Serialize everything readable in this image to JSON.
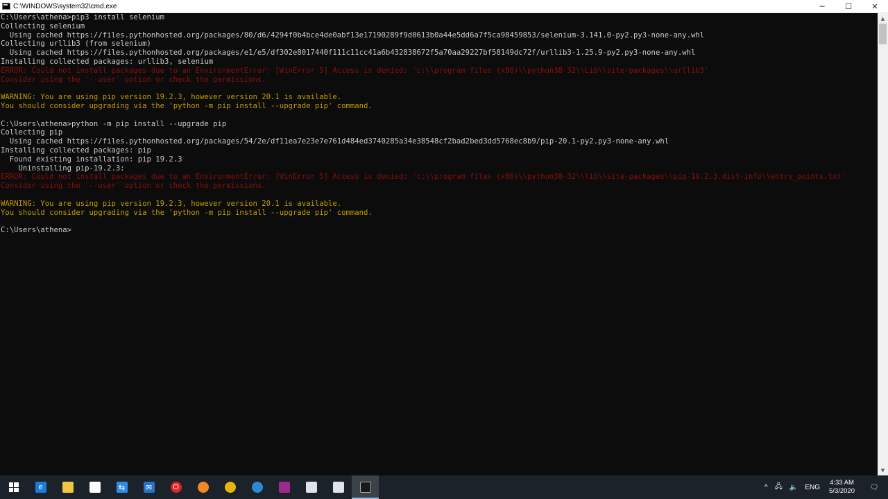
{
  "window": {
    "title": "C:\\WINDOWS\\system32\\cmd.exe",
    "controls": {
      "minimize": "─",
      "maximize": "☐",
      "close": "✕"
    }
  },
  "console": {
    "lines": [
      {
        "text": "C:\\Users\\athena>pip3 install selenium",
        "type": "normal"
      },
      {
        "text": "Collecting selenium",
        "type": "normal"
      },
      {
        "text": "  Using cached https://files.pythonhosted.org/packages/80/d6/4294f0b4bce4de0abf13e17190289f9d0613b0a44e5dd6a7f5ca98459853/selenium-3.141.0-py2.py3-none-any.whl",
        "type": "normal"
      },
      {
        "text": "Collecting urllib3 (from selenium)",
        "type": "normal"
      },
      {
        "text": "  Using cached https://files.pythonhosted.org/packages/e1/e5/df302e8017440f111c11cc41a6b432838672f5a70aa29227bf58149dc72f/urllib3-1.25.9-py2.py3-none-any.whl",
        "type": "normal"
      },
      {
        "text": "Installing collected packages: urllib3, selenium",
        "type": "normal"
      },
      {
        "text": "ERROR: Could not install packages due to an EnvironmentError: [WinError 5] Access is denied: 'c:\\\\program files (x86)\\\\python38-32\\\\Lib\\\\site-packages\\\\urllib3'",
        "type": "error"
      },
      {
        "text": "Consider using the `--user` option or check the permissions.",
        "type": "error"
      },
      {
        "text": "",
        "type": "normal"
      },
      {
        "text": "WARNING: You are using pip version 19.2.3, however version 20.1 is available.",
        "type": "warning"
      },
      {
        "text": "You should consider upgrading via the 'python -m pip install --upgrade pip' command.",
        "type": "warning"
      },
      {
        "text": "",
        "type": "normal"
      },
      {
        "text": "C:\\Users\\athena>python -m pip install --upgrade pip",
        "type": "normal"
      },
      {
        "text": "Collecting pip",
        "type": "normal"
      },
      {
        "text": "  Using cached https://files.pythonhosted.org/packages/54/2e/df11ea7e23e7e761d484ed3740285a34e38548cf2bad2bed3dd5768ec8b9/pip-20.1-py2.py3-none-any.whl",
        "type": "normal"
      },
      {
        "text": "Installing collected packages: pip",
        "type": "normal"
      },
      {
        "text": "  Found existing installation: pip 19.2.3",
        "type": "normal"
      },
      {
        "text": "    Uninstalling pip-19.2.3:",
        "type": "normal"
      },
      {
        "text": "ERROR: Could not install packages due to an EnvironmentError: [WinError 5] Access is denied: 'c:\\\\program files (x86)\\\\python38-32\\\\lib\\\\site-packages\\\\pip-19.2.3.dist-info\\\\entry_points.txt'",
        "type": "error"
      },
      {
        "text": "Consider using the `--user` option or check the permissions.",
        "type": "error"
      },
      {
        "text": "",
        "type": "normal"
      },
      {
        "text": "WARNING: You are using pip version 19.2.3, however version 20.1 is available.",
        "type": "warning"
      },
      {
        "text": "You should consider upgrading via the 'python -m pip install --upgrade pip' command.",
        "type": "warning"
      },
      {
        "text": "",
        "type": "normal"
      },
      {
        "text": "C:\\Users\\athena>",
        "type": "normal"
      }
    ],
    "colors": {
      "background": "#0c0c0c",
      "normal": "#cccccc",
      "error": "#8b0d0d",
      "warning": "#c19c00"
    }
  },
  "taskbar": {
    "apps": [
      {
        "name": "edge-icon",
        "color": "#1e7ad8",
        "glyph": "e"
      },
      {
        "name": "file-explorer-icon",
        "color": "#f0c541",
        "glyph": ""
      },
      {
        "name": "store-icon",
        "color": "#ffffff",
        "glyph": ""
      },
      {
        "name": "teamviewer-icon",
        "color": "#2d8cea",
        "glyph": "⇆"
      },
      {
        "name": "mail-icon",
        "color": "#2672c9",
        "glyph": "✉"
      },
      {
        "name": "opera-icon",
        "color": "#e02424",
        "glyph": "O"
      },
      {
        "name": "firefox-icon",
        "color": "#f08a24",
        "glyph": ""
      },
      {
        "name": "chrome-icon",
        "color": "#e8b30f",
        "glyph": ""
      },
      {
        "name": "browser-icon",
        "color": "#2a8ad6",
        "glyph": ""
      },
      {
        "name": "winrar-icon",
        "color": "#9a2a8c",
        "glyph": ""
      },
      {
        "name": "window-icon",
        "color": "#dfe4ea",
        "glyph": ""
      },
      {
        "name": "app-window-icon",
        "color": "#dfe4ea",
        "glyph": ""
      },
      {
        "name": "cmd-icon",
        "color": "#1a1a1a",
        "glyph": "",
        "active": true
      }
    ],
    "tray": {
      "chevron": "^",
      "network": "🖧",
      "volume": "🔈",
      "language": "ENG",
      "time": "4:33 AM",
      "date": "5/3/2020",
      "notifications": "🗨"
    }
  }
}
